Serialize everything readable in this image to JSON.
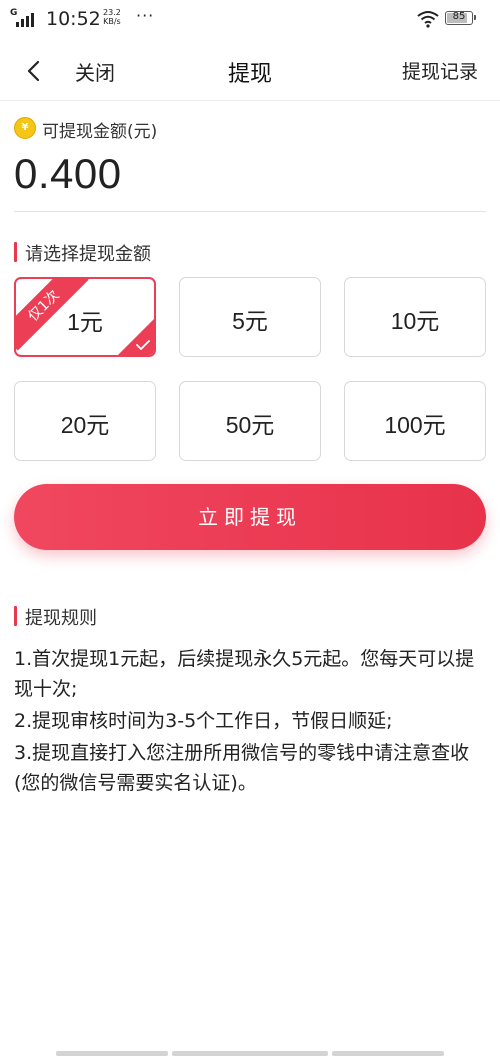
{
  "status_bar": {
    "network": "G",
    "time": "10:52",
    "speed_value": "23.2",
    "speed_unit": "KB/s",
    "more": "···",
    "battery": "85"
  },
  "header": {
    "close_label": "关闭",
    "title": "提现",
    "records_label": "提现记录"
  },
  "balance": {
    "coin_glyph": "¥",
    "label": "可提现金额(元)",
    "amount": "0.400"
  },
  "amount_section": {
    "title": "请选择提现金额",
    "options": [
      {
        "label": "1元",
        "badge": "仅1次",
        "selected": true
      },
      {
        "label": "5元"
      },
      {
        "label": "10元"
      },
      {
        "label": "20元"
      },
      {
        "label": "50元"
      },
      {
        "label": "100元"
      }
    ]
  },
  "withdraw_button": "立即提现",
  "rules": {
    "title": "提现规则",
    "items": [
      "1.首次提现1元起，后续提现永久5元起。您每天可以提现十次;",
      "2.提现审核时间为3-5个工作日，节假日顺延;",
      "3.提现直接打入您注册所用微信号的零钱中请注意查收(您的微信号需要实名认证)。"
    ]
  },
  "colors": {
    "accent": "#ec3f55",
    "coin": "#f5c518"
  }
}
